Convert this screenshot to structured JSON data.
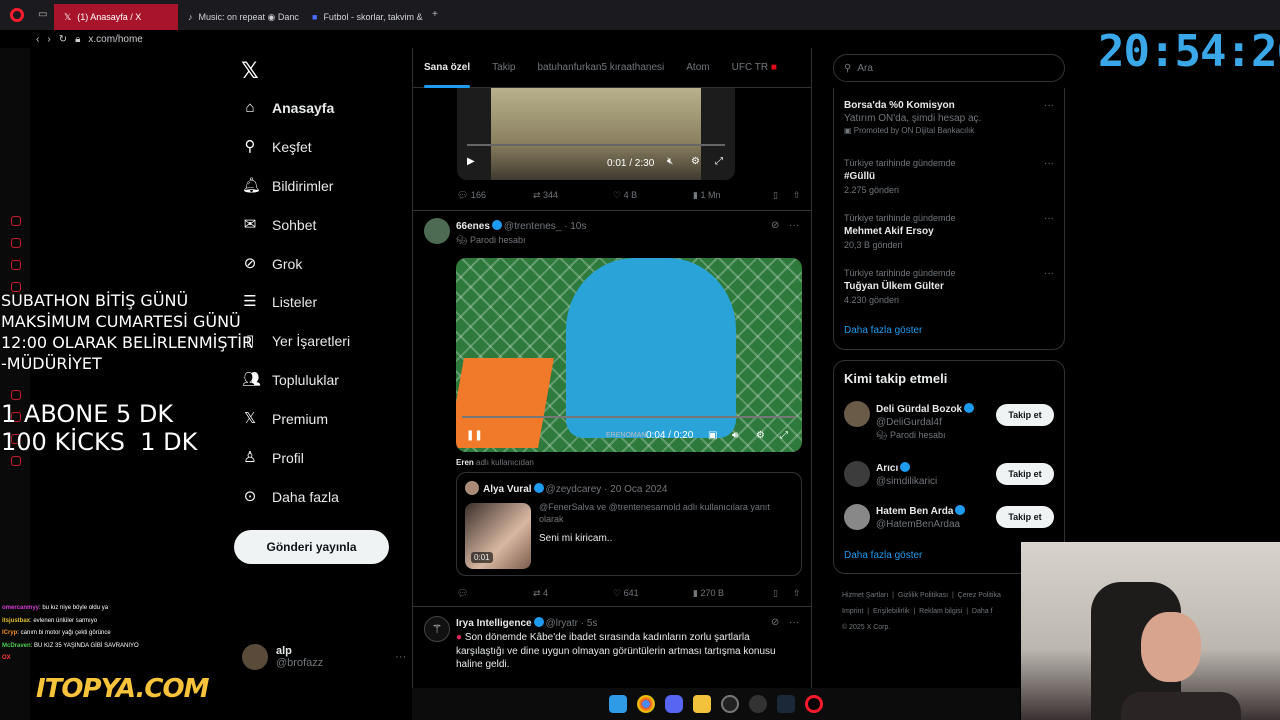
{
  "browser": {
    "tabs": [
      {
        "label": "(1) Anasayfa / X",
        "active": true
      },
      {
        "label": "Music: on repeat ◉ Danc",
        "active": false
      },
      {
        "label": "Futbol - skorlar, takvim &",
        "active": false
      }
    ],
    "url": "x.com/home",
    "accent": "#a8152b"
  },
  "overlay": {
    "line1": "SUBATHON BİTİŞ GÜNÜ",
    "line2": "MAKSİMUM CUMARTESİ GÜNÜ",
    "line3": "12:00 OLARAK BELİRLENMİŞTİR",
    "line4": "-MÜDÜRİYET",
    "line5": "1 ABONE 5 DK",
    "line6": "100 KİCKS  1 DK",
    "clock": "20:54:26",
    "sponsor": "ITOPYA.COM"
  },
  "nav": {
    "items": [
      {
        "label": "Anasayfa",
        "icon": "home-icon"
      },
      {
        "label": "Keşfet",
        "icon": "search-icon"
      },
      {
        "label": "Bildirimler",
        "icon": "bell-icon",
        "badge": "1"
      },
      {
        "label": "Sohbet",
        "icon": "mail-icon"
      },
      {
        "label": "Grok",
        "icon": "grok-icon"
      },
      {
        "label": "Listeler",
        "icon": "list-icon"
      },
      {
        "label": "Yer İşaretleri",
        "icon": "bookmark-icon"
      },
      {
        "label": "Topluluklar",
        "icon": "community-icon"
      },
      {
        "label": "Premium",
        "icon": "x-icon"
      },
      {
        "label": "Profil",
        "icon": "person-icon"
      },
      {
        "label": "Daha fazla",
        "icon": "more-icon"
      }
    ],
    "post_button": "Gönderi yayınla",
    "account": {
      "name": "alp",
      "handle": "@brofazz"
    }
  },
  "feed": {
    "tabs": [
      "Sana özel",
      "Takip",
      "batuhanfurkan5 kıraathanesi",
      "Atom",
      "UFC TR"
    ],
    "video1": {
      "time": "0:01 / 2:30"
    },
    "actions1": {
      "replies": "166",
      "reposts": "344",
      "likes": "4 B",
      "views": "1 Mn"
    },
    "tweet2": {
      "name": "66enes",
      "handle": "@trentenes_",
      "time": "· 10s",
      "label": "Parodi hesabı",
      "video_time": "0:04 / 0:20",
      "video_caption": "ERENOMAN",
      "replying": "Eren",
      "replying_suffix": "adlı kullanıcıdan",
      "quote": {
        "name": "Alya Vural",
        "handle": "@zeydcarey",
        "date": "· 20 Oca 2024",
        "reply_to": "@FenerSalva ve @trentenesarnold adlı kullanıcılara yanıt olarak",
        "text": "Seni mi kiricam..",
        "thumb_time": "0:01"
      },
      "actions": {
        "replies": "",
        "reposts": "4",
        "likes": "641",
        "views": "270 B"
      }
    },
    "tweet3": {
      "name": "Irya Intelligence",
      "handle": "@lryatr",
      "time": "· 5s",
      "text": "Son dönemde Kâbe'de ibadet sırasında kadınların zorlu şartlarla karşılaştığı ve dine uygun olmayan görüntülerin artması tartışma konusu haline geldi."
    }
  },
  "right": {
    "search_placeholder": "Ara",
    "promo": {
      "title": "Borsa'da %0 Komisyon",
      "sub": "Yatırım ON'da, şimdi hesap aç.",
      "promoted": "Promoted by ON Dijital Bankacılık"
    },
    "trends": [
      {
        "context": "Türkiye tarihinde gündemde",
        "title": "#Güllü",
        "count": "2.275 gönderi"
      },
      {
        "context": "Türkiye tarihinde gündemde",
        "title": "Mehmet Akif Ersoy",
        "count": "20,3 B gönderi"
      },
      {
        "context": "Türkiye tarihinde gündemde",
        "title": "Tuğyan Ülkem Gülter",
        "count": "4.230 gönderi"
      }
    ],
    "show_more": "Daha fazla göster",
    "who_to_follow": "Kimi takip etmeli",
    "follow": [
      {
        "name": "Deli Gürdal Bozok",
        "handle": "@DeliGurdal4f",
        "label": "Parodi hesabı"
      },
      {
        "name": "Arıcı",
        "handle": "@simdilikarici",
        "label": ""
      },
      {
        "name": "Hatem Ben Arda",
        "handle": "@HatemBenArdaa",
        "label": ""
      }
    ],
    "follow_button": "Takip et",
    "show_more2": "Daha fazla göster",
    "footer1": "Hizmet Şartları  |  Gizlilik Politikası  |  Çerez Politika",
    "footer2": "Imprint  |  Erişilebilirlik  |  Reklam bilgisi  |  Daha f",
    "footer3": "© 2025 X Corp."
  },
  "chat": [
    {
      "user": "omercanmyy",
      "msg": ": bu kız niye böyle oldu ya",
      "color": "#d43dd4"
    },
    {
      "user": "itsjustbax",
      "msg": ": evlenen ünlüler sarmıyo",
      "color": "#e0c030"
    },
    {
      "user": "ICryp",
      "msg": ": canım bi motor yağı çekti görünce",
      "color": "#f08a24"
    },
    {
      "user": "McDraven",
      "msg": ": BU KIZ 35 YAŞINDA GİBİ SAVRANIYO",
      "color": "#49c94e"
    },
    {
      "user": "OX",
      "msg": "",
      "color": "#ff3b3b"
    }
  ]
}
